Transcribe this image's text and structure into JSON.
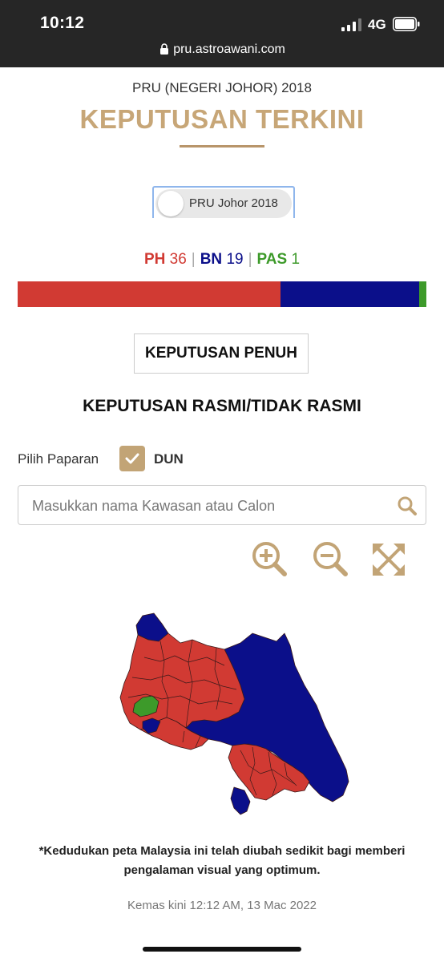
{
  "status_bar": {
    "time": "10:12",
    "network": "4G",
    "url": "pru.astroawani.com"
  },
  "header": {
    "subtitle": "PRU (NEGERI JOHOR) 2018",
    "title": "KEPUTUSAN TERKINI"
  },
  "election_toggle": {
    "label": "PRU Johor 2018"
  },
  "seats": {
    "parties": [
      {
        "code": "PH",
        "count": "36",
        "color": "#d13a33"
      },
      {
        "code": "BN",
        "count": "19",
        "color": "#0b0f8a"
      },
      {
        "code": "PAS",
        "count": "1",
        "color": "#3d9a2a"
      }
    ],
    "separator": "|"
  },
  "full_results_button": "KEPUTUSAN PENUH",
  "section_title": "KEPUTUSAN RASMI/TIDAK RASMI",
  "view_selector": {
    "label": "Pilih Paparan",
    "option": "DUN",
    "checked": true
  },
  "search": {
    "placeholder": "Masukkan nama Kawasan atau Calon",
    "icon": "search-icon"
  },
  "map_controls": {
    "icons": [
      "zoom-in-icon",
      "zoom-out-icon",
      "fullscreen-icon"
    ],
    "color": "#c2a476"
  },
  "map": {
    "region": "Johor",
    "colors": {
      "PH": "#d13a33",
      "BN": "#0b0f8a",
      "PAS": "#3d9a2a"
    }
  },
  "note": "*Kedudukan peta Malaysia ini telah diubah sedikit bagi memberi pengalaman visual yang optimum.",
  "updated": "Kemas kini 12:12 AM, 13 Mac 2022",
  "colors": {
    "accent_gold": "#c7a677",
    "status_bar_bg": "#262626"
  }
}
